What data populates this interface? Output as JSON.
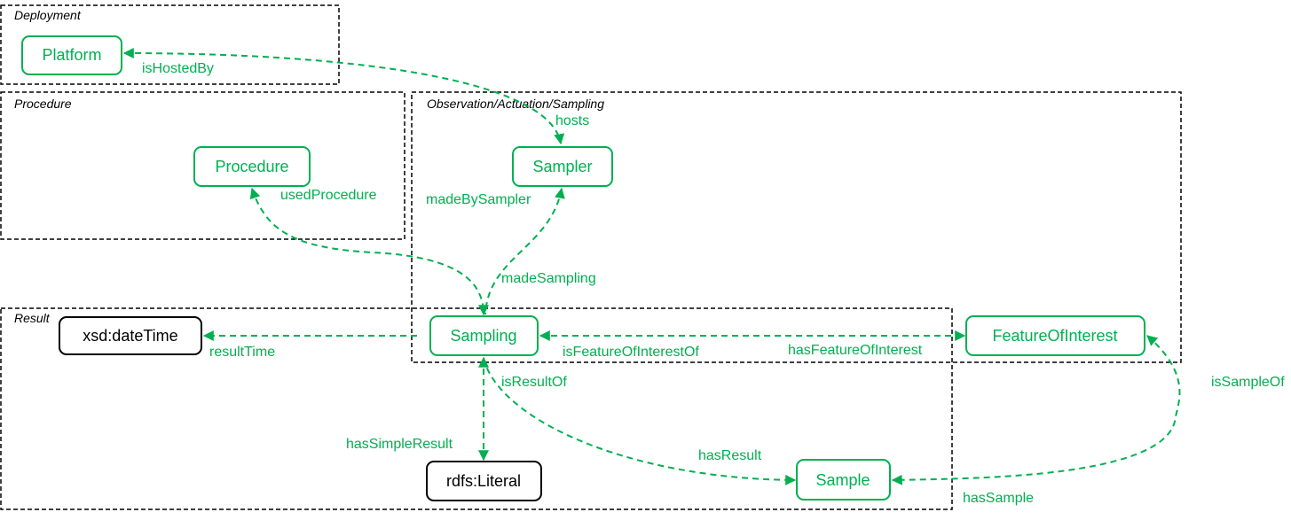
{
  "colors": {
    "accent": "#00b050",
    "black": "#000000"
  },
  "groups": {
    "deployment": "Deployment",
    "procedure": "Procedure",
    "observation": "Observation/Actuation/Sampling",
    "result": "Result"
  },
  "nodes": {
    "platform": "Platform",
    "procedure": "Procedure",
    "sampler": "Sampler",
    "datetime": "xsd:dateTime",
    "sampling": "Sampling",
    "foi": "FeatureOfInterest",
    "literal": "rdfs:Literal",
    "sample": "Sample"
  },
  "edges": {
    "isHostedBy": "isHostedBy",
    "hosts": "hosts",
    "usedProcedure": "usedProcedure",
    "madeBySampler": "madeBySampler",
    "madeSampling": "madeSampling",
    "resultTime": "resultTime",
    "isFeatureOfInterestOf": "isFeatureOfInterestOf",
    "hasFeatureOfInterest": "hasFeatureOfInterest",
    "isResultOf": "isResultOf",
    "hasSimpleResult": "hasSimpleResult",
    "hasResult": "hasResult",
    "isSampleOf": "isSampleOf",
    "hasSample": "hasSample"
  }
}
